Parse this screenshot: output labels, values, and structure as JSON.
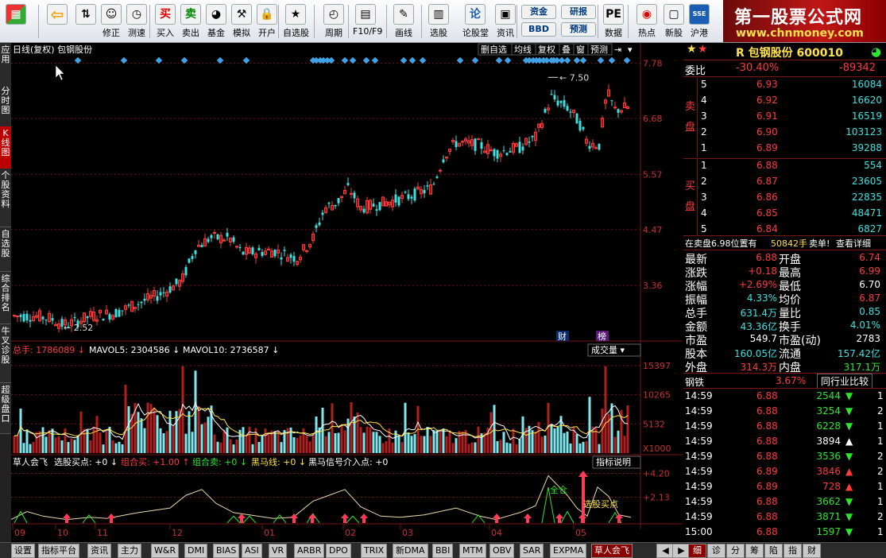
{
  "brand": {
    "title": "第一股票公式网",
    "url": "www.chnmoney.com"
  },
  "toolbar": [
    {
      "label": "",
      "icon": "windows-logo-icon",
      "glyph": "▦"
    },
    {
      "label": "",
      "icon": "back-arrow-icon",
      "glyph": "⇦"
    },
    {
      "label": "",
      "icon": "up-down-arrow-icon",
      "glyph": "⇅"
    },
    {
      "label": "修正",
      "icon": "smile-icon",
      "glyph": "☺"
    },
    {
      "label": "测速",
      "icon": "clock-icon",
      "glyph": "◷"
    },
    {
      "label": "买入",
      "icon": "buy-icon",
      "glyph": "买"
    },
    {
      "label": "卖出",
      "icon": "sell-icon",
      "glyph": "卖"
    },
    {
      "label": "基金",
      "icon": "fund-icon",
      "glyph": "◕"
    },
    {
      "label": "模拟",
      "icon": "hammer-icon",
      "glyph": "⚒"
    },
    {
      "label": "开户",
      "icon": "lock-icon",
      "glyph": "🔒"
    },
    {
      "label": "自选股",
      "icon": "star-folder-icon",
      "glyph": "★"
    },
    {
      "label": "周期",
      "icon": "period-icon",
      "glyph": "◴"
    },
    {
      "label": "F10/F9",
      "icon": "f10-icon",
      "glyph": "▤"
    },
    {
      "label": "画线",
      "icon": "pen-icon",
      "glyph": "✎"
    },
    {
      "label": "选股",
      "icon": "select-stock-icon",
      "glyph": "▥"
    },
    {
      "label": "论股堂",
      "icon": "forum-icon",
      "glyph": "论"
    },
    {
      "label": "资讯",
      "icon": "news-icon",
      "glyph": "▣"
    },
    {
      "label": "资金",
      "icon": "capital-icon",
      "glyph": "资金"
    },
    {
      "label": "BBD",
      "icon": "bbd-icon",
      "glyph": "BBD"
    },
    {
      "label": "研报",
      "icon": "research-icon",
      "glyph": "研报"
    },
    {
      "label": "预测",
      "icon": "forecast-icon",
      "glyph": "预测"
    },
    {
      "label": "数据",
      "icon": "pe-icon",
      "glyph": "PE"
    },
    {
      "label": "热点",
      "icon": "hotspot-icon",
      "glyph": "◉"
    },
    {
      "label": "新股",
      "icon": "new-stock-icon",
      "glyph": "▢"
    },
    {
      "label": "沪港",
      "icon": "hk-icon",
      "glyph": "SSE"
    }
  ],
  "left_tabs": [
    {
      "label": "应用",
      "active": false
    },
    {
      "label": "分时图",
      "active": false
    },
    {
      "label": "K线图",
      "active": true
    },
    {
      "label": "个股资料",
      "active": false
    },
    {
      "label": "自选股",
      "active": false
    },
    {
      "label": "综合排名",
      "active": false
    },
    {
      "label": "牛叉诊股",
      "active": false
    },
    {
      "label": "超级盘口",
      "active": false
    }
  ],
  "chart_header": {
    "title": "日线(复权) 包钢股份"
  },
  "chart_menu": [
    "删自选",
    "均线",
    "复权",
    "叠",
    "窗",
    "预测"
  ],
  "chart_menu_icons": [
    "pin-icon",
    "chevron-down-icon"
  ],
  "price_axis": [
    "7.78",
    "6.68",
    "5.57",
    "4.47",
    "3.36"
  ],
  "annotations": {
    "high": "7.50",
    "low": "2.52",
    "cai": "财",
    "bang": "榜"
  },
  "volume_header": {
    "total_label": "总手: 1786089",
    "mavol5": "MAVOL5: 2304586",
    "mavol10": "MAVOL10: 2736587",
    "dropdown": "成交量"
  },
  "volume_axis": [
    "15397",
    "10265",
    "5132",
    "X1000"
  ],
  "indicator_header": {
    "name": "草人会飞",
    "buy": "选股买点: +0",
    "group_buy": "组合买: +1.00",
    "group_sell": "组合卖: +0",
    "black_horse": "黑马线: +0",
    "black_horse_signal": "黑马信号介入点: +0",
    "desc_button": "指标说明"
  },
  "indicator_axis": [
    "+4.20",
    "+2.13"
  ],
  "indicator_labels": {
    "full": "全仓",
    "buy_point": "选股买点"
  },
  "date_axis": [
    "09",
    "10",
    "11",
    "12",
    "01",
    "02",
    "03",
    "04",
    "05"
  ],
  "chart_data": {
    "type": "candlestick",
    "title": "日线(复权) 包钢股份",
    "y_range": [
      2.3,
      7.9
    ],
    "price_ticks": [
      7.78,
      6.68,
      5.57,
      4.47,
      3.36
    ],
    "high": 7.5,
    "low": 2.52,
    "volume_ticks": [
      15397,
      10265,
      5132
    ],
    "volume_unit": "X1000",
    "indicator_ticks": [
      4.2,
      2.13
    ],
    "months": [
      "09",
      "10",
      "11",
      "12",
      "01",
      "02",
      "03",
      "04",
      "05"
    ],
    "series": [
      {
        "name": "MAVOL5",
        "last": 2304586
      },
      {
        "name": "MAVOL10",
        "last": 2736587
      }
    ]
  },
  "quote": {
    "name": "R 包钢股份",
    "code": "600010",
    "weibi_label": "委比",
    "weibi_pct": "-30.40%",
    "weibi_val": "-89342",
    "sell_label": "卖盘",
    "buy_label": "买盘",
    "asks": [
      {
        "lvl": "5",
        "price": "6.93",
        "vol": "16084"
      },
      {
        "lvl": "4",
        "price": "6.92",
        "vol": "16620"
      },
      {
        "lvl": "3",
        "price": "6.91",
        "vol": "16519"
      },
      {
        "lvl": "2",
        "price": "6.90",
        "vol": "103123"
      },
      {
        "lvl": "1",
        "price": "6.89",
        "vol": "39288"
      }
    ],
    "bids": [
      {
        "lvl": "1",
        "price": "6.88",
        "vol": "554"
      },
      {
        "lvl": "2",
        "price": "6.87",
        "vol": "23605"
      },
      {
        "lvl": "3",
        "price": "6.86",
        "vol": "22835"
      },
      {
        "lvl": "4",
        "price": "6.85",
        "vol": "48471"
      },
      {
        "lvl": "5",
        "price": "6.84",
        "vol": "6827"
      }
    ],
    "notice": {
      "text": "在卖盘6.98位置有",
      "vol": "50842手",
      "tail": "卖单!",
      "link": "查看详细"
    },
    "stats": [
      {
        "l1": "最新",
        "v1": "6.88",
        "l2": "开盘",
        "v2": "6.74"
      },
      {
        "l1": "涨跌",
        "v1": "+0.18",
        "l2": "最高",
        "v2": "6.99"
      },
      {
        "l1": "涨幅",
        "v1": "+2.69%",
        "l2": "最低",
        "v2": "6.70"
      },
      {
        "l1": "振幅",
        "v1": "4.33%",
        "l2": "均价",
        "v2": "6.87"
      },
      {
        "l1": "总手",
        "v1": "631.4万",
        "l2": "量比",
        "v2": "0.85"
      },
      {
        "l1": "金额",
        "v1": "43.36亿",
        "l2": "换手",
        "v2": "4.01%"
      },
      {
        "l1": "市盈",
        "v1": "549.7",
        "l2": "市盈(动)",
        "v2": "2783"
      },
      {
        "l1": "股本",
        "v1": "160.05亿",
        "l2": "流通",
        "v2": "157.42亿"
      },
      {
        "l1": "外盘",
        "v1": "314.3万",
        "l2": "内盘",
        "v2": "317.1万"
      }
    ],
    "industry": {
      "name": "钢铁",
      "pct": "3.67%",
      "compare": "同行业比较"
    },
    "ticks": [
      {
        "time": "14:59",
        "price": "6.88",
        "vol": "2544",
        "dir": "down",
        "n": "1"
      },
      {
        "time": "14:59",
        "price": "6.88",
        "vol": "3254",
        "dir": "down",
        "n": "2"
      },
      {
        "time": "14:59",
        "price": "6.88",
        "vol": "6228",
        "dir": "down",
        "n": "1"
      },
      {
        "time": "14:59",
        "price": "6.88",
        "vol": "3894",
        "dir": "up",
        "n": "1"
      },
      {
        "time": "14:59",
        "price": "6.88",
        "vol": "3536",
        "dir": "down",
        "n": "2"
      },
      {
        "time": "14:59",
        "price": "6.89",
        "vol": "3846",
        "dir": "up",
        "n": "2"
      },
      {
        "time": "14:59",
        "price": "6.89",
        "vol": "728",
        "dir": "up",
        "n": "1"
      },
      {
        "time": "14:59",
        "price": "6.88",
        "vol": "3662",
        "dir": "down",
        "n": "1"
      },
      {
        "time": "14:59",
        "price": "6.88",
        "vol": "3871",
        "dir": "down",
        "n": "2"
      },
      {
        "time": "15:00",
        "price": "6.88",
        "vol": "1597",
        "dir": "down",
        "n": "1"
      }
    ]
  },
  "bottom_tabs": [
    "设置",
    "指标平台",
    "资讯",
    "主力",
    "W&R",
    "DMI",
    "BIAS",
    "ASI",
    "VR",
    "ARBR",
    "DPO",
    "TRIX",
    "新DMA",
    "BBI",
    "MTM",
    "OBV",
    "SAR",
    "EXPMA",
    "草人会飞"
  ],
  "bottom_active": "草人会飞",
  "right_tabs": [
    "细",
    "诊",
    "分",
    "筹",
    "陷",
    "指",
    "财"
  ],
  "colors": {
    "up": "#ff3b3b",
    "down": "#3fe0e0",
    "vol_up": "#b02020",
    "vol_down": "#7fe8ee",
    "grid": "#7a1414",
    "axis_text": "#c83030",
    "yellow": "#ffe24a",
    "green": "#2ee62e",
    "cyan": "#3fe0e0",
    "diamond": "#3da3e6"
  }
}
